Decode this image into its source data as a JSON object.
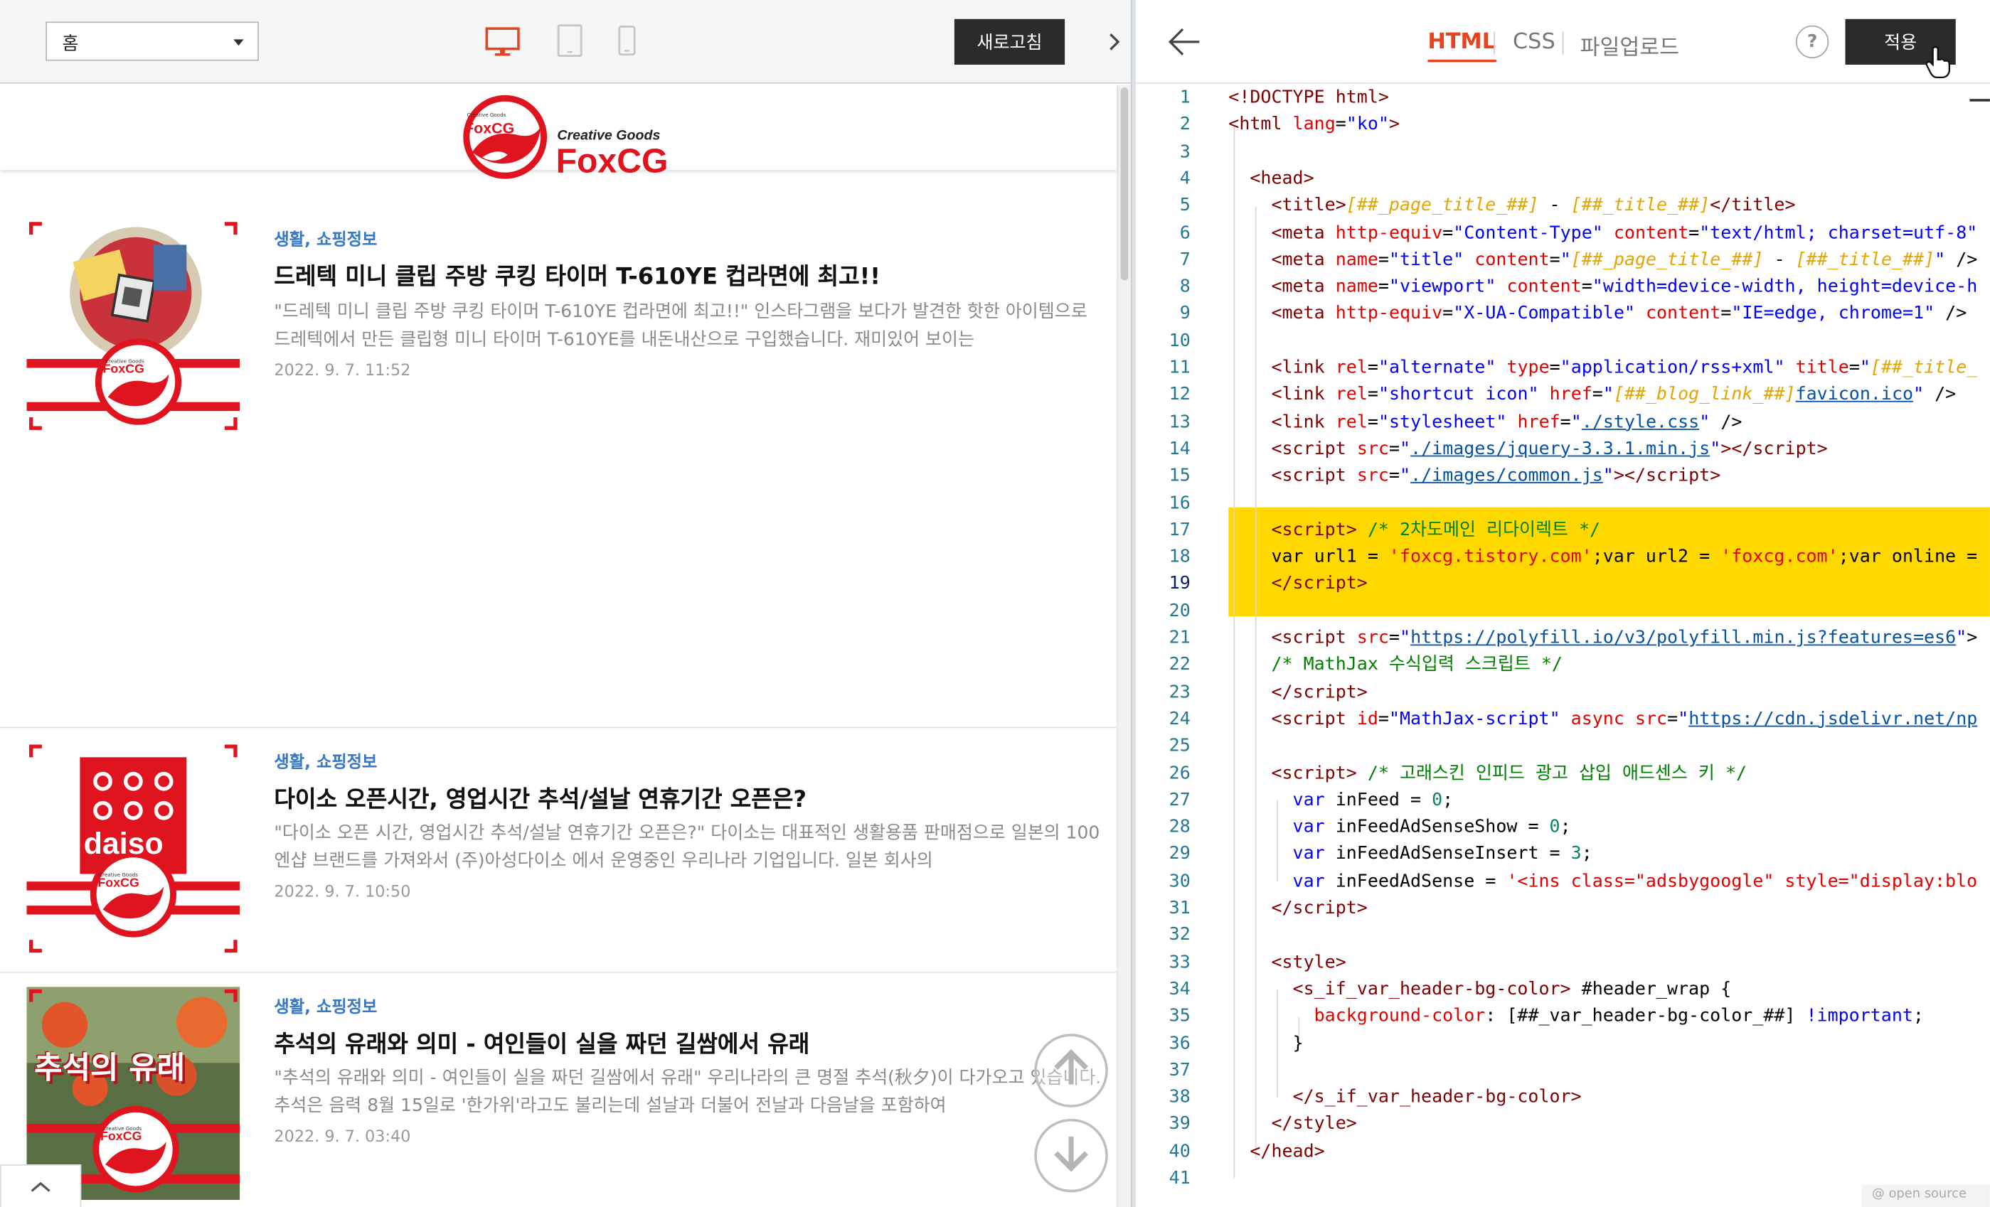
{
  "left_toolbar": {
    "page_select_value": "홈",
    "refresh_label": "새로고침",
    "device_buttons": [
      "desktop-icon",
      "tablet-icon",
      "mobile-icon"
    ]
  },
  "blog": {
    "logo_small": "Creative Goods",
    "logo_brand": "FoxCG",
    "logo_tagline": "Creative Goods",
    "logo_title": "FoxCG"
  },
  "posts": [
    {
      "category": "생활, 쇼핑정보",
      "title": "드레텍 미니 클립 주방 쿠킹 타이머 T-610YE 컵라면에 최고!!",
      "excerpt": "\"드레텍 미니 클립 주방 쿠킹 타이머 T-610YE 컵라면에 최고!!\" 인스타그램을 보다가 발견한 핫한 아이템으로 드레텍에서 만든 클립형 미니 타이머 T-610YE를 내돈내산으로 구입했습니다. 재미있어 보이는",
      "date": "2022. 9. 7. 11:52"
    },
    {
      "category": "생활, 쇼핑정보",
      "title": "다이소 오픈시간, 영업시간 추석/설날 연휴기간 오픈은?",
      "excerpt": "\"다이소 오픈 시간, 영업시간 추석/설날 연휴기간 오픈은?\" 다이소는 대표적인 생활용품 판매점으로 일본의 100엔샵 브랜드를 가져와서 (주)아성다이소 에서 운영중인 우리나라 기업입니다. 일본 회사의",
      "date": "2022. 9. 7. 10:50"
    },
    {
      "category": "생활, 쇼핑정보",
      "title": "추석의 유래와 의미 - 여인들이 실을 짜던 길쌈에서 유래",
      "excerpt": "\"추석의 유래와 의미 - 여인들이 실을 짜던 길쌈에서 유래\" 우리나라의 큰 명절 추석(秋夕)이 다가오고 있습니다. 추석은 음력 8월 15일로 '한가위'라고도 불리는데 설날과 더불어 전날과 다음날을 포함하여",
      "date": "2022. 9. 7. 03:40"
    }
  ],
  "thumb_text": {
    "daiso": "daiso",
    "chuseok": "추석의 유래",
    "brand": "FoxCG",
    "brand_small": "Creative Goods"
  },
  "right_toolbar": {
    "tabs": [
      "HTML",
      "CSS",
      "파일업로드"
    ],
    "active_tab": "HTML",
    "help_label": "?",
    "apply_label": "적용"
  },
  "editor": {
    "line_numbers": [
      "1",
      "2",
      "3",
      "4",
      "5",
      "6",
      "7",
      "8",
      "9",
      "10",
      "11",
      "12",
      "13",
      "14",
      "15",
      "16",
      "17",
      "18",
      "19",
      "20",
      "21",
      "22",
      "23",
      "24",
      "25",
      "26",
      "27",
      "28",
      "29",
      "30",
      "31",
      "32",
      "33",
      "34",
      "35",
      "36",
      "37",
      "38",
      "39",
      "40",
      "41"
    ],
    "current_line": "19",
    "highlight_color": "#ffd800",
    "footer_note": "@ open source"
  },
  "colors": {
    "accent": "#e8421f",
    "brand_red": "#e0141e",
    "category_blue": "#3a78c3",
    "dark_button": "#2b2b2b"
  }
}
